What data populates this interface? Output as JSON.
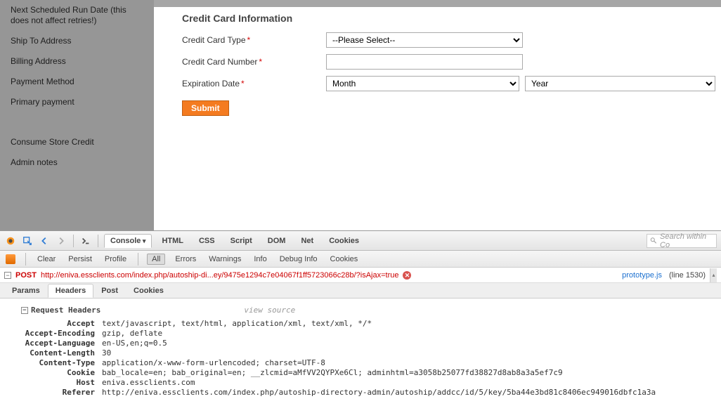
{
  "sidebar": {
    "items": [
      "Next Scheduled Run Date (this does not affect retries!)",
      "Ship To Address",
      "Billing Address",
      "Payment Method",
      "Primary payment"
    ],
    "items2": [
      "Consume Store Credit",
      "Admin notes"
    ]
  },
  "form": {
    "section_title": "Credit Card Information",
    "labels": {
      "cc_type": "Credit Card Type",
      "cc_number": "Credit Card Number",
      "exp_date": "Expiration Date"
    },
    "placeholders": {
      "cc_type": "--Please Select--",
      "month": "Month",
      "year": "Year"
    },
    "submit": "Submit"
  },
  "devtools": {
    "main_tabs": [
      "Console",
      "HTML",
      "CSS",
      "Script",
      "DOM",
      "Net",
      "Cookies"
    ],
    "active_main_tab": "Console",
    "search_placeholder": "Search within Co",
    "toolbar2": [
      "Clear",
      "Persist",
      "Profile",
      "All",
      "Errors",
      "Warnings",
      "Info",
      "Debug Info",
      "Cookies"
    ],
    "active_tb2": "All",
    "request": {
      "method": "POST",
      "url": "http://eniva.essclients.com/index.php/autoship-di...ey/9475e1294c7e04067f1ff5723066c28b/?isAjax=true",
      "source": "prototype.js",
      "line": "(line 1530)"
    },
    "subtabs": [
      "Params",
      "Headers",
      "Post",
      "Cookies"
    ],
    "active_subtab": "Headers",
    "headers_group": "Request Headers",
    "view_source": "view source",
    "headers": [
      {
        "k": "Accept",
        "v": "text/javascript, text/html, application/xml, text/xml, */*"
      },
      {
        "k": "Accept-Encoding",
        "v": "gzip, deflate"
      },
      {
        "k": "Accept-Language",
        "v": "en-US,en;q=0.5"
      },
      {
        "k": "Content-Length",
        "v": "30"
      },
      {
        "k": "Content-Type",
        "v": "application/x-www-form-urlencoded; charset=UTF-8"
      },
      {
        "k": "Cookie",
        "v": "bab_locale=en; bab_original=en; __zlcmid=aMfVV2QYPXe6Cl; adminhtml=a3058b25077fd38827d8ab8a3a5ef7c9"
      },
      {
        "k": "Host",
        "v": "eniva.essclients.com"
      },
      {
        "k": "Referer",
        "v": "http://eniva.essclients.com/index.php/autoship-directory-admin/autoship/addcc/id/5/key/5ba44e3bd81c8406ec949016dbfc1a3a"
      }
    ]
  }
}
